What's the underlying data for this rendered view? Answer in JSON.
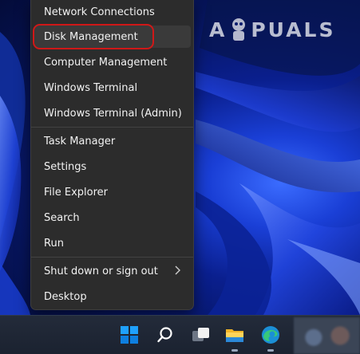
{
  "menu": {
    "items": [
      {
        "label": "Network Connections"
      },
      {
        "label": "Disk Management"
      },
      {
        "label": "Computer Management"
      },
      {
        "label": "Windows Terminal"
      },
      {
        "label": "Windows Terminal (Admin)"
      },
      {
        "label": "Task Manager"
      },
      {
        "label": "Settings"
      },
      {
        "label": "File Explorer"
      },
      {
        "label": "Search"
      },
      {
        "label": "Run"
      },
      {
        "label": "Shut down or sign out"
      },
      {
        "label": "Desktop"
      }
    ],
    "highlighted_item": "Disk Management",
    "highlight_color": "#d01818",
    "submenu_icon": "chevron-right-icon"
  },
  "watermark": {
    "text": "A PUALS"
  },
  "taskbar": {
    "icons": [
      "windows-start-icon",
      "search-icon",
      "task-view-icon",
      "file-explorer-icon",
      "edge-browser-icon"
    ],
    "accent": "#0078d4"
  }
}
